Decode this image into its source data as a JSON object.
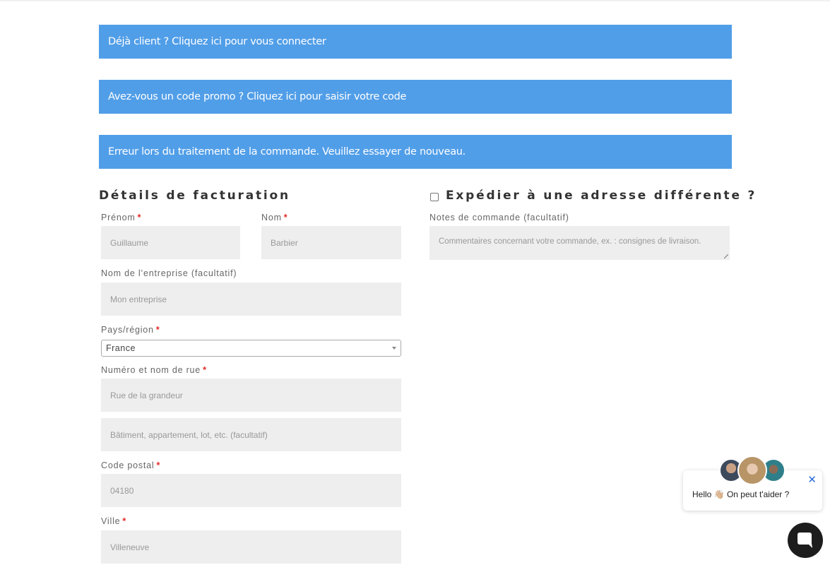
{
  "notices": {
    "login": "Déjà client ? Cliquez ici pour vous connecter",
    "coupon": "Avez-vous un code promo ? Cliquez ici pour saisir votre code",
    "error": "Erreur lors du traitement de la commande. Veuillez essayer de nouveau."
  },
  "billing": {
    "title": "Détails de facturation",
    "first_name": {
      "label": "Prénom",
      "value": "Guillaume"
    },
    "last_name": {
      "label": "Nom",
      "value": "Barbier"
    },
    "company": {
      "label": "Nom de l’entreprise (facultatif)",
      "placeholder": "Mon entreprise"
    },
    "country": {
      "label": "Pays/région",
      "value": "France"
    },
    "street": {
      "label": "Numéro et nom de rue",
      "value": "Rue de la grandeur"
    },
    "street2": {
      "placeholder": "Bâtiment, appartement, lot, etc. (facultatif)"
    },
    "postcode": {
      "label": "Code postal",
      "value": "04180"
    },
    "city": {
      "label": "Ville",
      "value": "Villeneuve"
    },
    "required_mark": "*"
  },
  "shipping": {
    "title": "Expédier à une adresse différente ?",
    "notes": {
      "label": "Notes de commande (facultatif)",
      "placeholder": "Commentaires concernant votre commande, ex. : consignes de livraison."
    }
  },
  "chat": {
    "greeting": "Hello 👋🏼 On peut t'aider ?",
    "close_glyph": "✕"
  },
  "colors": {
    "notice_bg": "#519ee8",
    "required": "#e02b27",
    "field_bg": "#eeeeee"
  }
}
